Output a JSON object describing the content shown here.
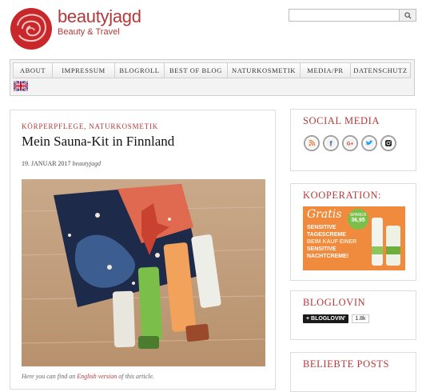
{
  "brand": {
    "name": "beautyjagd",
    "tagline": "Beauty & Travel"
  },
  "search": {
    "placeholder": "",
    "value": ""
  },
  "nav": {
    "items": [
      "ABOUT",
      "IMPRESSUM",
      "BLOGROLL",
      "BEST OF BLOG",
      "NATURKOSMETIK",
      "MEDIA/PR",
      "DATENSCHUTZ"
    ],
    "language_icon": "uk-flag-icon"
  },
  "post": {
    "categories": "KÖRPERPFLEGE, NATURKOSMETIK",
    "title": "Mein Sauna-Kit in Finnland",
    "date": "19. JANUAR 2017",
    "author": "beautyjagd",
    "note_prefix": "Here you can find an ",
    "note_link": "English version",
    "note_suffix": " of this article."
  },
  "sidebar": {
    "social": {
      "title": "SOCIAL MEDIA",
      "icons": [
        "rss-icon",
        "facebook-icon",
        "google-plus-icon",
        "twitter-icon",
        "instagram-icon"
      ]
    },
    "kooperation": {
      "title": "KOOPERATION:",
      "ad": {
        "line1": "Gratis",
        "line2": "SENSITIVE",
        "line3": "TAGESCREME",
        "line4": "BEIM KAUF EINER",
        "line5": "SENSITIVE",
        "line6": "NACHTCREME!",
        "badge_top": "SPAREN",
        "badge_value": "36,95"
      }
    },
    "bloglovin": {
      "title": "BLOGLOVIN",
      "button_label": "+ BLOGLOVIN'",
      "count": "1.8k"
    },
    "popular": {
      "title": "BELIEBTE POSTS"
    }
  },
  "colors": {
    "accent": "#b3393a",
    "nav_bg": "#f3f3f3",
    "ad_bg": "#f08a3c"
  }
}
